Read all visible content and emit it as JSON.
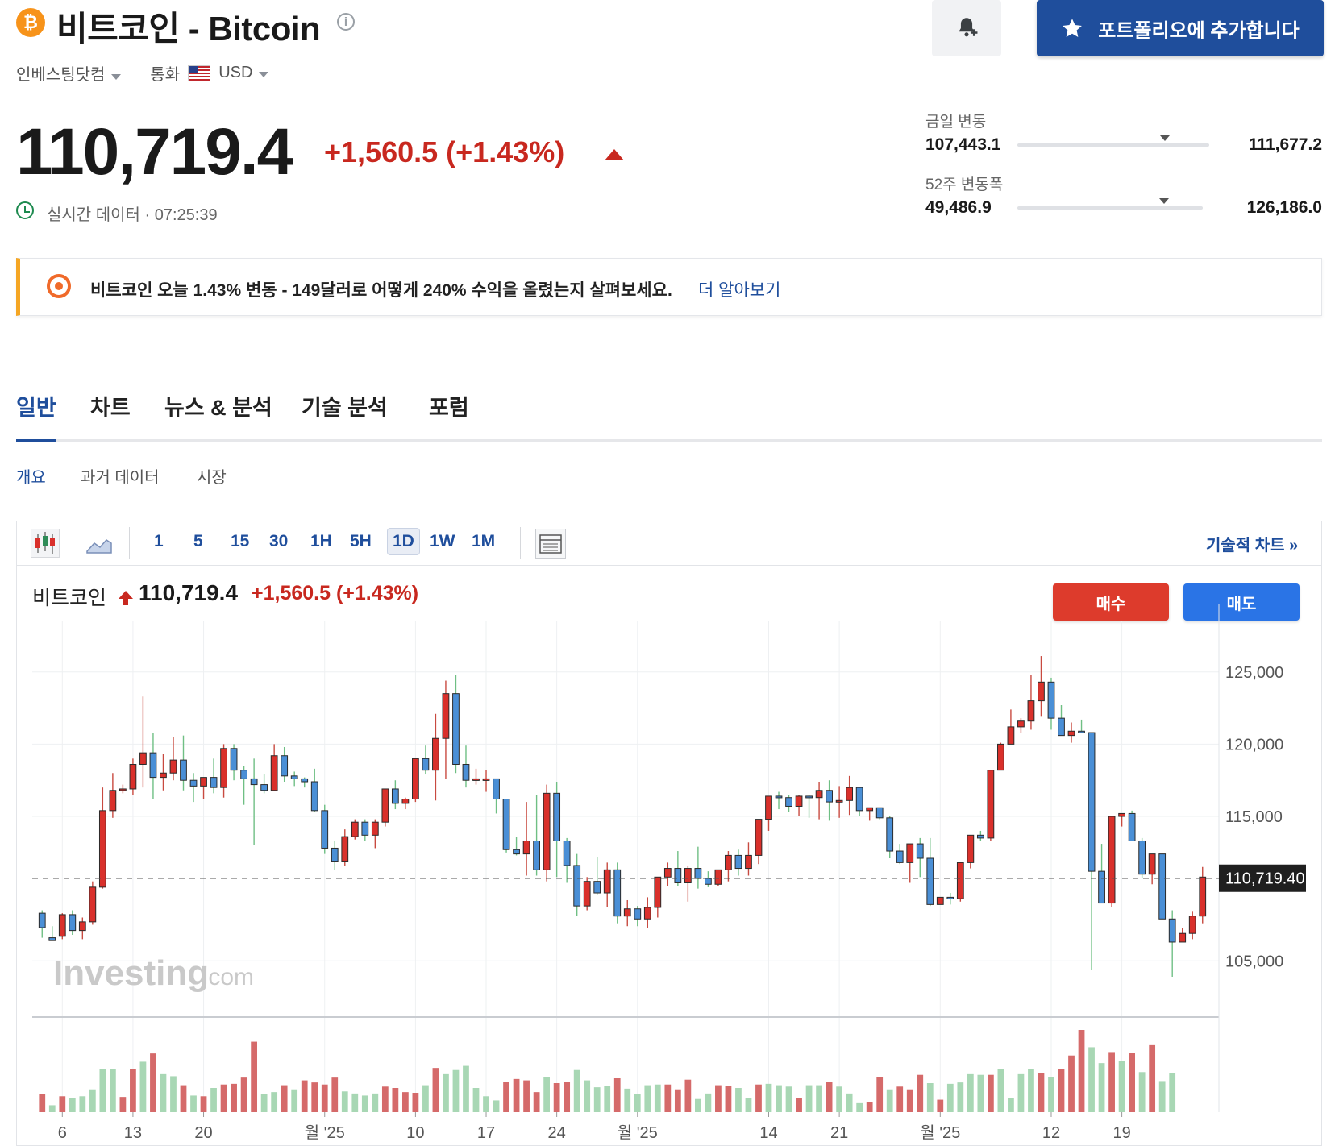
{
  "header": {
    "coin_symbol": "₿",
    "title": "비트코인 - Bitcoin",
    "info": "i",
    "portfolio_label": "포트폴리오에 추가합니다",
    "source_label": "인베스팅닷컴",
    "currency_label": "통화",
    "currency": "USD"
  },
  "quote": {
    "price": "110,719.4",
    "change": "+1,560.5",
    "change_pct": "(+1.43%)",
    "realtime": "실시간 데이터 · 07:25:39"
  },
  "ranges": {
    "day_label": "금일 변동",
    "day_low": "107,443.1",
    "day_high": "111,677.2",
    "day_position": 0.77,
    "week52_label": "52주 변동폭",
    "week52_low": "49,486.9",
    "week52_high": "126,186.0",
    "week52_position": 0.79
  },
  "banner": {
    "text": "비트코인 오늘 1.43% 변동 - 149달러로 어떻게 240% 수익을 올렸는지 살펴보세요.",
    "link": "더 알아보기"
  },
  "tabs": [
    "일반",
    "차트",
    "뉴스 & 분석",
    "기술 분석",
    "포럼"
  ],
  "subtabs": [
    "개요",
    "과거 데이터",
    "시장"
  ],
  "toolbar": {
    "timeframes": [
      "1",
      "5",
      "15",
      "30",
      "1H",
      "5H",
      "1D",
      "1W",
      "1M"
    ],
    "active_timeframe": "1D",
    "tech_chart_link": "기술적 차트 »"
  },
  "chart_legend": {
    "name": "비트코인",
    "price": "110,719.4",
    "change": "+1,560.5",
    "change_pct": "(+1.43%)",
    "buy": "매수",
    "sell": "매도"
  },
  "watermark": {
    "brand": "Investing",
    "suffix": ".com"
  },
  "colors": {
    "up": "#d9302b",
    "down": "#4a8fd6",
    "vol_up": "#d56a6a",
    "vol_down": "#a8d7b4",
    "accent": "#1f4e9c"
  },
  "chart_data": {
    "type": "candlestick",
    "y_ticks": [
      "125,000",
      "120,000",
      "115,000",
      "105,000"
    ],
    "y_tick_values": [
      125000,
      120000,
      115000,
      105000
    ],
    "ylim": [
      101500,
      128000
    ],
    "current_price_label": "110,719.40",
    "current_price": 110719.4,
    "x_ticks": [
      "6",
      "13",
      "20",
      "월 '25",
      "10",
      "17",
      "24",
      "월 '25",
      "14",
      "21",
      "월 '25",
      "12",
      "19"
    ],
    "x_tick_index": [
      2,
      9,
      16,
      28,
      37,
      44,
      51,
      59,
      72,
      79,
      89,
      100,
      107
    ],
    "candles": [
      [
        108300,
        108500,
        107300,
        106600
      ],
      [
        106600,
        107400,
        106400,
        106700
      ],
      [
        106700,
        108300,
        108200,
        106500
      ],
      [
        108200,
        108500,
        107100,
        106800
      ],
      [
        107100,
        108000,
        107700,
        106500
      ],
      [
        107700,
        110500,
        110100,
        107500
      ],
      [
        110100,
        117000,
        115400,
        110000
      ],
      [
        115400,
        118000,
        116800,
        114900
      ],
      [
        116800,
        117200,
        116900,
        116600
      ],
      [
        116900,
        119000,
        118600,
        116500
      ],
      [
        118600,
        123300,
        119400,
        117000
      ],
      [
        119400,
        120800,
        117700,
        116200
      ],
      [
        117700,
        119300,
        118000,
        116800
      ],
      [
        118000,
        120500,
        118900,
        117500
      ],
      [
        118900,
        120600,
        117500,
        116800
      ],
      [
        117500,
        118000,
        117100,
        116000
      ],
      [
        117100,
        117600,
        117700,
        116200
      ],
      [
        117700,
        119000,
        117000,
        116600
      ],
      [
        117000,
        120000,
        119700,
        116300
      ],
      [
        119700,
        120000,
        118200,
        117500
      ],
      [
        118200,
        118500,
        117600,
        115800
      ],
      [
        117600,
        119000,
        117200,
        113000
      ],
      [
        117200,
        117900,
        116800,
        116600
      ],
      [
        116800,
        120000,
        119200,
        116900
      ],
      [
        119200,
        119800,
        117800,
        117400
      ],
      [
        117800,
        118100,
        117600,
        117100
      ],
      [
        117600,
        117700,
        117400,
        117000
      ],
      [
        117400,
        118300,
        115400,
        115300
      ],
      [
        115400,
        115800,
        112800,
        112400
      ],
      [
        112800,
        113300,
        111900,
        111300
      ],
      [
        111900,
        114100,
        113600,
        111600
      ],
      [
        113600,
        114800,
        114600,
        113400
      ],
      [
        114600,
        114800,
        113700,
        113300
      ],
      [
        113700,
        114800,
        114600,
        112800
      ],
      [
        114600,
        116800,
        116900,
        114300
      ],
      [
        116900,
        117500,
        115900,
        115500
      ],
      [
        115900,
        116300,
        116200,
        115500
      ],
      [
        116200,
        118400,
        119000,
        116000
      ],
      [
        119000,
        119900,
        118200,
        117900
      ],
      [
        118200,
        122100,
        120400,
        116100
      ],
      [
        120400,
        124400,
        123500,
        117600
      ],
      [
        123500,
        124800,
        118600,
        118000
      ],
      [
        118600,
        119900,
        117500,
        117000
      ],
      [
        117500,
        118300,
        117600,
        117200
      ],
      [
        117600,
        118200,
        117600,
        116700
      ],
      [
        117600,
        117300,
        116200,
        115200
      ],
      [
        116200,
        116100,
        112700,
        112500
      ],
      [
        112700,
        113600,
        112400,
        112300
      ],
      [
        112400,
        116000,
        113300,
        110900
      ],
      [
        113300,
        116500,
        111300,
        110900
      ],
      [
        111300,
        117200,
        116600,
        110500
      ],
      [
        116600,
        117400,
        113300,
        110800
      ],
      [
        113300,
        113500,
        111600,
        110400
      ],
      [
        111600,
        112400,
        108800,
        108100
      ],
      [
        108800,
        110800,
        110500,
        108500
      ],
      [
        110500,
        112200,
        109700,
        109600
      ],
      [
        109700,
        111800,
        111300,
        108700
      ],
      [
        111300,
        111800,
        108100,
        107600
      ],
      [
        108100,
        109200,
        108600,
        107400
      ],
      [
        108600,
        108800,
        107900,
        107400
      ],
      [
        107900,
        109400,
        108700,
        107300
      ],
      [
        108700,
        110800,
        110800,
        108000
      ],
      [
        110800,
        111800,
        111400,
        110200
      ],
      [
        111400,
        112600,
        110400,
        110200
      ],
      [
        110400,
        111600,
        111400,
        109100
      ],
      [
        111400,
        112900,
        110700,
        110000
      ],
      [
        110700,
        111200,
        110300,
        110100
      ],
      [
        110300,
        111300,
        111300,
        110200
      ],
      [
        111300,
        112600,
        112300,
        110500
      ],
      [
        112300,
        112700,
        111400,
        110900
      ],
      [
        111400,
        113200,
        112300,
        110900
      ],
      [
        112300,
        113900,
        114800,
        111700
      ],
      [
        114800,
        114900,
        116400,
        114000
      ],
      [
        116400,
        116700,
        116300,
        115500
      ],
      [
        116300,
        116500,
        115700,
        115300
      ],
      [
        115700,
        116500,
        116400,
        115000
      ],
      [
        116400,
        116500,
        116300,
        114900
      ],
      [
        116300,
        117400,
        116800,
        114800
      ],
      [
        116800,
        117500,
        116000,
        114700
      ],
      [
        116000,
        117100,
        116100,
        114900
      ],
      [
        116100,
        117800,
        117000,
        115100
      ],
      [
        117000,
        116600,
        115400,
        115000
      ],
      [
        115400,
        115500,
        115600,
        114700
      ],
      [
        115600,
        115500,
        114900,
        114800
      ],
      [
        114900,
        115000,
        112600,
        112100
      ],
      [
        112600,
        113100,
        111800,
        111700
      ],
      [
        111800,
        112800,
        113100,
        110400
      ],
      [
        113100,
        113500,
        112100,
        110800
      ],
      [
        112100,
        113500,
        108900,
        108800
      ],
      [
        108900,
        109300,
        109400,
        108900
      ],
      [
        109400,
        109700,
        109300,
        108900
      ],
      [
        109300,
        109700,
        111800,
        109100
      ],
      [
        111800,
        113500,
        113700,
        111400
      ],
      [
        113700,
        114000,
        113500,
        113300
      ],
      [
        113500,
        115800,
        118200,
        113300
      ],
      [
        118200,
        120100,
        120000,
        118200
      ],
      [
        120000,
        122400,
        121200,
        120000
      ],
      [
        121200,
        121800,
        121600,
        120800
      ],
      [
        121600,
        124800,
        123000,
        121000
      ],
      [
        123000,
        126100,
        124300,
        121900
      ],
      [
        124300,
        124600,
        121800,
        121000
      ],
      [
        121800,
        122700,
        120600,
        120600
      ],
      [
        120600,
        121500,
        120900,
        120100
      ],
      [
        120900,
        121700,
        120800,
        121000
      ],
      [
        120800,
        119300,
        111200,
        104400
      ],
      [
        111200,
        113100,
        109000,
        109000
      ],
      [
        109000,
        114500,
        115000,
        108700
      ],
      [
        115000,
        114600,
        115200,
        114300
      ],
      [
        115200,
        115400,
        113300,
        113300
      ],
      [
        113300,
        113500,
        111000,
        110700
      ],
      [
        111000,
        112400,
        112400,
        110300
      ],
      [
        112400,
        112100,
        107900,
        107900
      ],
      [
        107900,
        108500,
        106300,
        103900
      ],
      [
        106300,
        107300,
        106900,
        106700
      ],
      [
        106900,
        108400,
        108100,
        106500
      ],
      [
        108100,
        111500,
        110800,
        107600
      ]
    ],
    "volumes": [
      [
        26,
        "up"
      ],
      [
        10,
        "down"
      ],
      [
        23,
        "up"
      ],
      [
        21,
        "down"
      ],
      [
        23,
        "down"
      ],
      [
        33,
        "down"
      ],
      [
        62,
        "down"
      ],
      [
        63,
        "down"
      ],
      [
        22,
        "up"
      ],
      [
        62,
        "up"
      ],
      [
        73,
        "down"
      ],
      [
        85,
        "up"
      ],
      [
        55,
        "down"
      ],
      [
        52,
        "down"
      ],
      [
        39,
        "up"
      ],
      [
        24,
        "down"
      ],
      [
        23,
        "up"
      ],
      [
        35,
        "down"
      ],
      [
        40,
        "up"
      ],
      [
        41,
        "up"
      ],
      [
        50,
        "up"
      ],
      [
        102,
        "up"
      ],
      [
        26,
        "down"
      ],
      [
        29,
        "down"
      ],
      [
        39,
        "up"
      ],
      [
        33,
        "down"
      ],
      [
        46,
        "up"
      ],
      [
        43,
        "up"
      ],
      [
        40,
        "up"
      ],
      [
        50,
        "up"
      ],
      [
        30,
        "down"
      ],
      [
        27,
        "down"
      ],
      [
        24,
        "down"
      ],
      [
        27,
        "down"
      ],
      [
        37,
        "up"
      ],
      [
        35,
        "up"
      ],
      [
        29,
        "up"
      ],
      [
        28,
        "up"
      ],
      [
        39,
        "down"
      ],
      [
        64,
        "up"
      ],
      [
        55,
        "down"
      ],
      [
        61,
        "down"
      ],
      [
        67,
        "down"
      ],
      [
        35,
        "down"
      ],
      [
        23,
        "down"
      ],
      [
        17,
        "down"
      ],
      [
        44,
        "up"
      ],
      [
        48,
        "up"
      ],
      [
        46,
        "up"
      ],
      [
        29,
        "up"
      ],
      [
        51,
        "down"
      ],
      [
        42,
        "up"
      ],
      [
        44,
        "up"
      ],
      [
        61,
        "down"
      ],
      [
        46,
        "down"
      ],
      [
        36,
        "down"
      ],
      [
        38,
        "down"
      ],
      [
        49,
        "up"
      ],
      [
        34,
        "down"
      ],
      [
        26,
        "down"
      ],
      [
        39,
        "down"
      ],
      [
        40,
        "down"
      ],
      [
        40,
        "up"
      ],
      [
        33,
        "up"
      ],
      [
        47,
        "up"
      ],
      [
        19,
        "down"
      ],
      [
        27,
        "down"
      ],
      [
        39,
        "up"
      ],
      [
        38,
        "up"
      ],
      [
        35,
        "down"
      ],
      [
        20,
        "down"
      ],
      [
        40,
        "up"
      ],
      [
        41,
        "down"
      ],
      [
        39,
        "down"
      ],
      [
        37,
        "down"
      ],
      [
        20,
        "up"
      ],
      [
        39,
        "down"
      ],
      [
        39,
        "down"
      ],
      [
        44,
        "up"
      ],
      [
        37,
        "down"
      ],
      [
        27,
        "down"
      ],
      [
        13,
        "down"
      ],
      [
        14,
        "up"
      ],
      [
        51,
        "up"
      ],
      [
        33,
        "down"
      ],
      [
        37,
        "up"
      ],
      [
        33,
        "up"
      ],
      [
        54,
        "up"
      ],
      [
        42,
        "down"
      ],
      [
        18,
        "up"
      ],
      [
        41,
        "down"
      ],
      [
        43,
        "down"
      ],
      [
        55,
        "down"
      ],
      [
        54,
        "down"
      ],
      [
        54,
        "up"
      ],
      [
        62,
        "down"
      ],
      [
        20,
        "down"
      ],
      [
        55,
        "down"
      ],
      [
        62,
        "down"
      ],
      [
        56,
        "up"
      ],
      [
        51,
        "down"
      ],
      [
        62,
        "up"
      ],
      [
        82,
        "up"
      ],
      [
        119,
        "up"
      ],
      [
        94,
        "down"
      ],
      [
        71,
        "down"
      ],
      [
        87,
        "up"
      ],
      [
        74,
        "down"
      ],
      [
        86,
        "up"
      ],
      [
        58,
        "down"
      ],
      [
        97,
        "up"
      ],
      [
        45,
        "down"
      ],
      [
        56,
        "down"
      ]
    ]
  }
}
